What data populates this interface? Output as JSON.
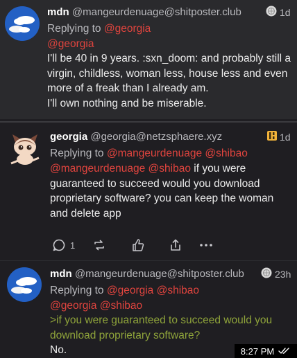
{
  "posts": [
    {
      "display_name": "mdn",
      "handle": "@mangeurdenuage@shitposter.club",
      "time": "1d",
      "replying_prefix": "Replying to ",
      "replying_to": "@georgia",
      "mention": "@georgia",
      "body_lines": [
        "I'll be 40 in 9 years. :sxn_doom: and probably still a",
        "virgin, childless, woman less, house less and even",
        "more of a freak than I already am.",
        "I'll own nothing and be miserable."
      ]
    },
    {
      "display_name": "georgia",
      "handle": "@georgia@netzsphaere.xyz",
      "time": "1d",
      "replying_prefix": "Replying to ",
      "replying_to": "@mangeurdenuage @shibao",
      "mention": "@mangeurdenuage @shibao",
      "body_first_suffix": " if you were",
      "body_lines": [
        "guaranteed to succeed would you download",
        "proprietary software? you can keep the woman",
        "and delete app"
      ],
      "reply_count": "1"
    },
    {
      "display_name": "mdn",
      "handle": "@mangeurdenuage@shitposter.club",
      "time": "23h",
      "replying_prefix": "Replying to ",
      "replying_to": "@georgia @shibao",
      "mention": "@georgia @shibao",
      "quote_lines": [
        ">if you were guaranteed to succeed would you",
        "download proprietary software?"
      ],
      "body_lines": [
        "No."
      ]
    }
  ],
  "status_bar": {
    "time": "8:27 PM"
  },
  "colors": {
    "mention": "#e0443e",
    "greentext": "#8ea33a",
    "background": "#1f1e22"
  }
}
